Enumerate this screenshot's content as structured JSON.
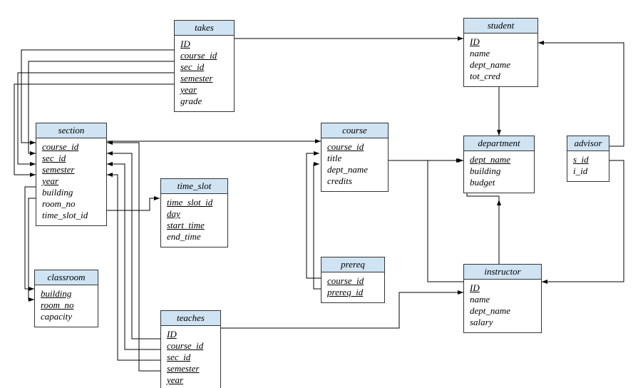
{
  "entities": {
    "takes": {
      "title": "takes",
      "attrs": [
        {
          "name": "ID",
          "pk": true
        },
        {
          "name": "course_id",
          "pk": true
        },
        {
          "name": "sec_id",
          "pk": true
        },
        {
          "name": "semester",
          "pk": true
        },
        {
          "name": "year",
          "pk": true
        },
        {
          "name": "grade",
          "pk": false
        }
      ]
    },
    "student": {
      "title": "student",
      "attrs": [
        {
          "name": "ID",
          "pk": true
        },
        {
          "name": "name",
          "pk": false
        },
        {
          "name": "dept_name",
          "pk": false
        },
        {
          "name": "tot_cred",
          "pk": false
        }
      ]
    },
    "section": {
      "title": "section",
      "attrs": [
        {
          "name": "course_id",
          "pk": true
        },
        {
          "name": "sec_id",
          "pk": true
        },
        {
          "name": "semester",
          "pk": true
        },
        {
          "name": "year",
          "pk": true
        },
        {
          "name": "building",
          "pk": false
        },
        {
          "name": "room_no",
          "pk": false
        },
        {
          "name": "time_slot_id",
          "pk": false
        }
      ]
    },
    "course": {
      "title": "course",
      "attrs": [
        {
          "name": "course_id",
          "pk": true
        },
        {
          "name": "title",
          "pk": false
        },
        {
          "name": "dept_name",
          "pk": false
        },
        {
          "name": "credits",
          "pk": false
        }
      ]
    },
    "department": {
      "title": "department",
      "attrs": [
        {
          "name": "dept_name",
          "pk": true
        },
        {
          "name": "building",
          "pk": false
        },
        {
          "name": "budget",
          "pk": false
        }
      ]
    },
    "advisor": {
      "title": "advisor",
      "attrs": [
        {
          "name": "s_id",
          "pk": true
        },
        {
          "name": "i_id",
          "pk": false
        }
      ]
    },
    "time_slot": {
      "title": "time_slot",
      "attrs": [
        {
          "name": "time_slot_id",
          "pk": true
        },
        {
          "name": "day",
          "pk": true
        },
        {
          "name": "start_time",
          "pk": true
        },
        {
          "name": "end_time",
          "pk": false
        }
      ]
    },
    "prereq": {
      "title": "prereq",
      "attrs": [
        {
          "name": "course_id",
          "pk": true
        },
        {
          "name": "prereq_id",
          "pk": true
        }
      ]
    },
    "instructor": {
      "title": "instructor",
      "attrs": [
        {
          "name": "ID",
          "pk": true
        },
        {
          "name": "name",
          "pk": false
        },
        {
          "name": "dept_name",
          "pk": false
        },
        {
          "name": "salary",
          "pk": false
        }
      ]
    },
    "classroom": {
      "title": "classroom",
      "attrs": [
        {
          "name": "building",
          "pk": true
        },
        {
          "name": "room_no",
          "pk": true
        },
        {
          "name": "capacity",
          "pk": false
        }
      ]
    },
    "teaches": {
      "title": "teaches",
      "attrs": [
        {
          "name": "ID",
          "pk": true
        },
        {
          "name": "course_id",
          "pk": true
        },
        {
          "name": "sec_id",
          "pk": true
        },
        {
          "name": "semester",
          "pk": true
        },
        {
          "name": "year",
          "pk": true
        }
      ]
    }
  }
}
